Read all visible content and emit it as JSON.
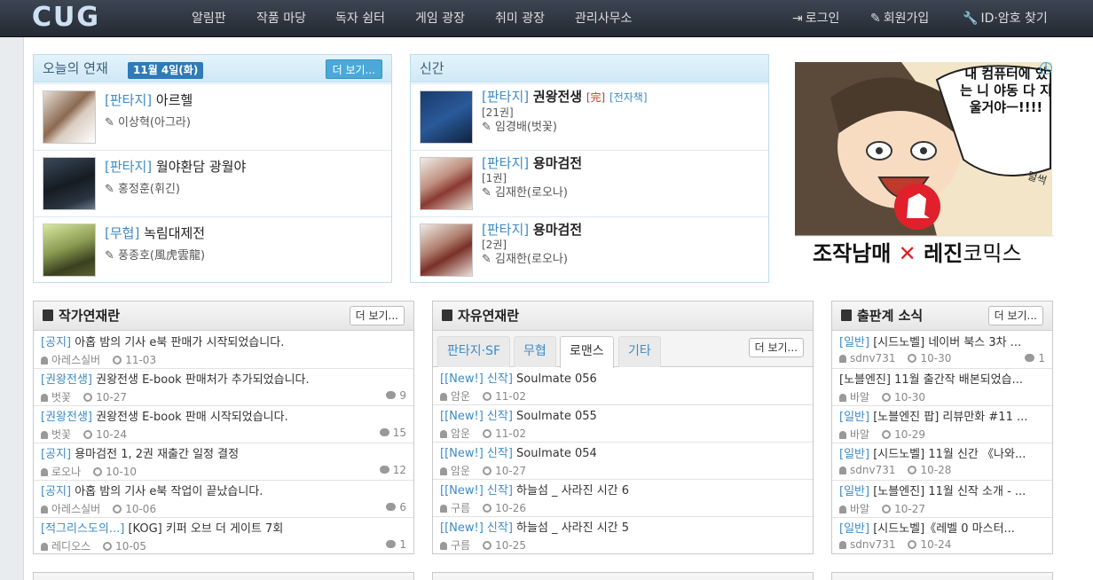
{
  "nav": {
    "logo": "CUG",
    "items": [
      "알림판",
      "작품 마당",
      "독자 쉼터",
      "게임 광장",
      "취미 광장",
      "관리사무소"
    ],
    "login": "로그인",
    "signup": "회원가입",
    "find": "ID·암호 찾기"
  },
  "today": {
    "title": "오늘의 연재",
    "date": "11월 4일(화)",
    "more": "더 보기...",
    "books": [
      {
        "genre": "[판타지]",
        "name": "아르헬",
        "author": "이상혁(아그라)"
      },
      {
        "genre": "[판타지]",
        "name": "월야환담 광월야",
        "author": "홍정훈(휘긴)"
      },
      {
        "genre": "[무협]",
        "name": "녹림대제전",
        "author": "풍종호(風虎雲龍)"
      }
    ]
  },
  "newbooks": {
    "title": "신간",
    "books": [
      {
        "genre": "[판타지]",
        "name": "권왕전생",
        "tag1": "[完]",
        "tag2": "[전자책]",
        "vol": "[21권]",
        "author": "임경배(벗꽃)"
      },
      {
        "genre": "[판타지]",
        "name": "용마검전",
        "vol": "[1권]",
        "author": "김재한(로오나)"
      },
      {
        "genre": "[판타지]",
        "name": "용마검전",
        "vol": "[2권]",
        "author": "김재한(로오나)"
      }
    ]
  },
  "ad": {
    "bubble": "내 컴퓨터에 있는 니 야동 다 지울거야ㅡ!!!!",
    "brand1": "조작남매",
    "brand2": "레진",
    "brand3": "코믹스",
    "sfx": "털썩"
  },
  "author_board": {
    "title": "작가연재란",
    "more": "더 보기...",
    "rows": [
      {
        "cat": "[공지]",
        "title": "아홉 밤의 기사 e북 판매가 시작되었습니다.",
        "user": "아레스실버",
        "date": "11-03",
        "count": ""
      },
      {
        "cat": "[권왕전생]",
        "title": "권왕전생 E-book 판매처가 추가되었습니다.",
        "user": "벗꽃",
        "date": "10-27",
        "count": "9"
      },
      {
        "cat": "[권왕전생]",
        "title": "권왕전생 E-book 판매 시작되었습니다.",
        "user": "벗꽃",
        "date": "10-24",
        "count": "15"
      },
      {
        "cat": "[공지]",
        "title": "용마검전 1, 2권 재출간 일정 결정",
        "user": "로오나",
        "date": "10-10",
        "count": "12"
      },
      {
        "cat": "[공지]",
        "title": "아홉 밤의 기사 e북 작업이 끝났습니다.",
        "user": "아레스실버",
        "date": "10-06",
        "count": "6"
      },
      {
        "cat": "[적그리스도의...]",
        "title": "[KOG] 키퍼 오브 더 게이트 7회",
        "user": "레디오스",
        "date": "10-05",
        "count": "1"
      }
    ]
  },
  "free_board": {
    "title": "자유연재란",
    "more": "더 보기...",
    "tabs": [
      "판타지·SF",
      "무협",
      "로맨스",
      "기타"
    ],
    "rows": [
      {
        "cat": "[[New!] 신작]",
        "title": "Soulmate 056",
        "user": "암운",
        "date": "11-02"
      },
      {
        "cat": "[[New!] 신작]",
        "title": "Soulmate 055",
        "user": "암운",
        "date": "11-02"
      },
      {
        "cat": "[[New!] 신작]",
        "title": "Soulmate 054",
        "user": "암운",
        "date": "10-27"
      },
      {
        "cat": "[[New!] 신작]",
        "title": "하늘섬 _ 사라진 시간 6",
        "user": "구름",
        "date": "10-26"
      },
      {
        "cat": "[[New!] 신작]",
        "title": "하늘섬 _ 사라진 시간 5",
        "user": "구름",
        "date": "10-25"
      }
    ]
  },
  "pub_board": {
    "title": "출판계 소식",
    "more": "더 보기...",
    "rows": [
      {
        "cat": "[일반]",
        "title": "[시드노벨] 네이버 북스 3차 ...",
        "user": "sdnv731",
        "date": "10-30",
        "count": "1"
      },
      {
        "cat": "",
        "title": "[노블엔진] 11월 출간작 배본되었습...",
        "user": "바알",
        "date": "10-30",
        "count": ""
      },
      {
        "cat": "[일반]",
        "title": "[노블엔진 팝] 리뷰만화 #11 ...",
        "user": "바알",
        "date": "10-29",
        "count": ""
      },
      {
        "cat": "[일반]",
        "title": "[시드노벨] 11월 신간 《나와...",
        "user": "sdnv731",
        "date": "10-28",
        "count": ""
      },
      {
        "cat": "[일반]",
        "title": "[노블엔진] 11월 신작 소개 - ...",
        "user": "바알",
        "date": "10-27",
        "count": ""
      },
      {
        "cat": "[일반]",
        "title": "[시드노벨]《레벨 0 마스터...",
        "user": "sdnv731",
        "date": "10-24",
        "count": ""
      }
    ]
  }
}
